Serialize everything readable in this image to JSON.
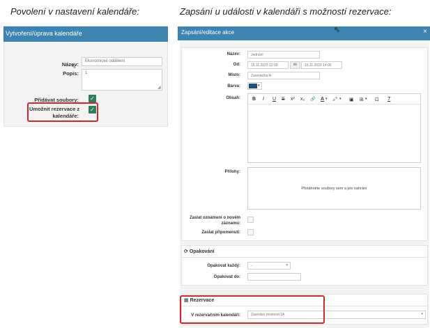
{
  "captions": {
    "left": "Povolení v nastavení kalendáře:",
    "right": "Zapsání u události v kalendáři s možností rezervace:"
  },
  "left_form": {
    "title": "Vytvoření/úprava kalendáře",
    "name_label": "Název:",
    "name_value": "Ekonomické oddělení",
    "desc_label": "Popis:",
    "desc_value": "1",
    "files_label": "Přidávat soubory:",
    "reserve_label_1": "Umožnit rezervace z",
    "reserve_label_2": "kalendáře:"
  },
  "right_form": {
    "title": "Zapsání/editace akce",
    "close_symbol": "×",
    "name_label": "Název:",
    "name_value": "Jednání",
    "from_label": "Od:",
    "from_value": "15.11.2023 12:00",
    "to_label": "do",
    "to_value": "15.11.2023 14:00",
    "place_label": "Místo:",
    "place_value": "Zasedačka A",
    "color_label": "Barva:",
    "color_value": "#1f4e79",
    "content_label": "Obsah:",
    "toolbar": {
      "bold": "B",
      "italic": "I",
      "underline": "U",
      "strike": "S",
      "superscript": "x²",
      "subscript": "x₂",
      "link": "🔗",
      "font_color": "A",
      "highlight": "🖍",
      "image": "▣",
      "table": "⊞",
      "fullscreen": "⊡",
      "clear_format": "T"
    },
    "attachments_label": "Přílohy:",
    "dropzone_text": "Přetáhněte soubory sem a pro nahrání",
    "notify_label_1": "Zaslat oznámení o novém",
    "notify_label_2": "záznamu:",
    "reminder_label": "Zaslat připomenutí:",
    "repeat_section": "Opakování",
    "repeat_every_label": "Opakovat každý:",
    "repeat_every_value": "-",
    "repeat_until_label": "Opakovat do:",
    "reservation_section": "Rezervace",
    "reservation_calendar_label": "V rezervačním kalendáři:",
    "reservation_calendar_value": "Zasedací místnost 1A"
  }
}
